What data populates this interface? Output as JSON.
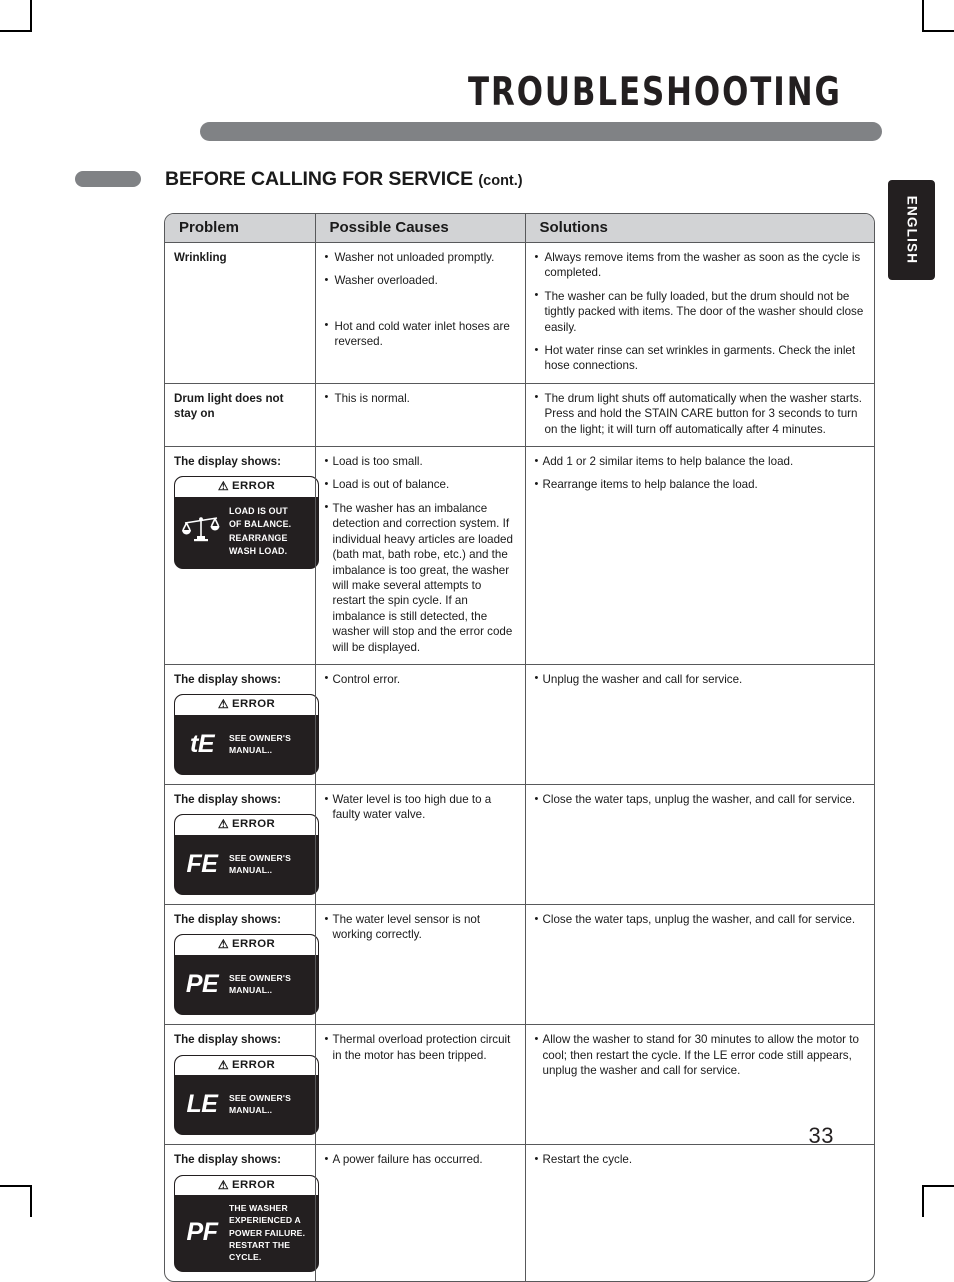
{
  "document": {
    "header_title": "TROUBLESHOOTING",
    "section_heading": "BEFORE CALLING FOR SERVICE",
    "section_heading_suffix": "(cont.)",
    "language_tab": "ENGLISH",
    "page_number": "33",
    "accent_gray": "#808285",
    "header_fill": "#d2d3d5",
    "rule_color": "#58595b",
    "display_bg": "#231f20"
  },
  "table": {
    "columns": [
      "Problem",
      "Possible Causes",
      "Solutions"
    ],
    "rows": [
      {
        "problem": "Wrinkling",
        "causes": [
          "Washer not unloaded promptly.",
          "Washer overloaded.",
          "Hot and cold water inlet hoses are reversed."
        ],
        "solutions": [
          "Always remove items from the washer as soon as the cycle is completed.",
          "The washer can be fully loaded, but the drum should not be tightly packed with items. The door of the washer should close easily.",
          "Hot water rinse can set wrinkles in garments. Check the inlet hose connections."
        ]
      },
      {
        "problem": "Drum light does not stay on",
        "causes": [
          "This is normal."
        ],
        "solutions": [
          "The drum light shuts off automatically when the washer starts. Press and hold the STAIN CARE button for 3 seconds to turn on the light; it will turn off automatically after 4 minutes."
        ]
      },
      {
        "problem": "The display shows:",
        "display": {
          "header": "ERROR",
          "icon": "balance-scale-icon",
          "code": "",
          "message_lines": [
            "LOAD IS OUT",
            "OF BALANCE.",
            "REARRANGE",
            "WASH LOAD."
          ]
        },
        "causes": [
          "Load is too small.",
          "Load is out of balance.",
          "The washer has an imbalance detection and correction system. If individual heavy articles are loaded (bath mat, bath robe, etc.) and the imbalance is too great, the washer will make several attempts to restart the spin cycle. If an imbalance is still detected, the washer will stop and the error code will be displayed."
        ],
        "solutions": [
          "Add 1 or 2 similar items to help balance the load.",
          "Rearrange items to help balance the load."
        ]
      },
      {
        "problem": "The display shows:",
        "display": {
          "header": "ERROR",
          "code": "tE",
          "message_lines": [
            "SEE OWNER'S",
            "MANUAL.."
          ]
        },
        "causes": [
          "Control error."
        ],
        "solutions": [
          "Unplug the washer and call for service."
        ]
      },
      {
        "problem": "The display shows:",
        "display": {
          "header": "ERROR",
          "code": "FE",
          "message_lines": [
            "SEE OWNER'S",
            "MANUAL.."
          ]
        },
        "causes": [
          "Water level is too high due to a faulty water valve."
        ],
        "solutions": [
          "Close the water taps, unplug the washer, and call for service."
        ]
      },
      {
        "problem": "The display shows:",
        "display": {
          "header": "ERROR",
          "code": "PE",
          "message_lines": [
            "SEE OWNER'S",
            "MANUAL.."
          ]
        },
        "causes": [
          "The water level sensor is not working correctly."
        ],
        "solutions": [
          "Close the water taps, unplug the washer, and call for service."
        ]
      },
      {
        "problem": "The display shows:",
        "display": {
          "header": "ERROR",
          "code": "LE",
          "message_lines": [
            "SEE OWNER'S",
            "MANUAL.."
          ]
        },
        "causes": [
          "Thermal overload protection circuit in the motor has been tripped."
        ],
        "solutions": [
          "Allow the washer to stand for 30 minutes to allow the motor to cool; then restart the cycle. If the LE error code still appears, unplug the washer and call for service."
        ]
      },
      {
        "problem": "The display shows:",
        "display": {
          "header": "ERROR",
          "code": "PF",
          "message_lines": [
            "THE WASHER",
            "EXPERIENCED A",
            "POWER FAILURE.",
            "RESTART THE",
            "CYCLE."
          ]
        },
        "causes": [
          "A power failure has occurred."
        ],
        "solutions": [
          "Restart the cycle."
        ]
      }
    ]
  }
}
